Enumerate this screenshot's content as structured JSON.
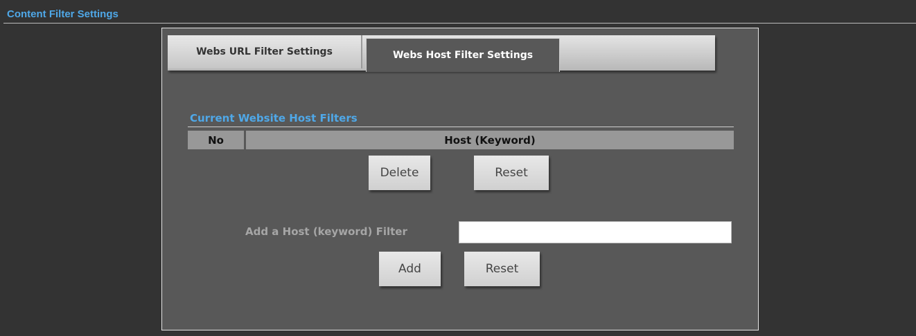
{
  "header": {
    "title": "Content Filter Settings",
    "accent_color": "#4fa8e8"
  },
  "tabs": [
    {
      "label": "Webs URL Filter Settings",
      "active": false
    },
    {
      "label": "Webs Host Filter Settings",
      "active": true
    }
  ],
  "host_filters": {
    "section_title": "Current Website Host Filters",
    "columns": [
      "No",
      "Host (Keyword)"
    ],
    "rows": [],
    "delete_label": "Delete",
    "reset_label": "Reset"
  },
  "add_filter": {
    "label": "Add a Host (keyword) Filter",
    "value": "",
    "placeholder": "",
    "add_label": "Add",
    "reset_label": "Reset"
  }
}
